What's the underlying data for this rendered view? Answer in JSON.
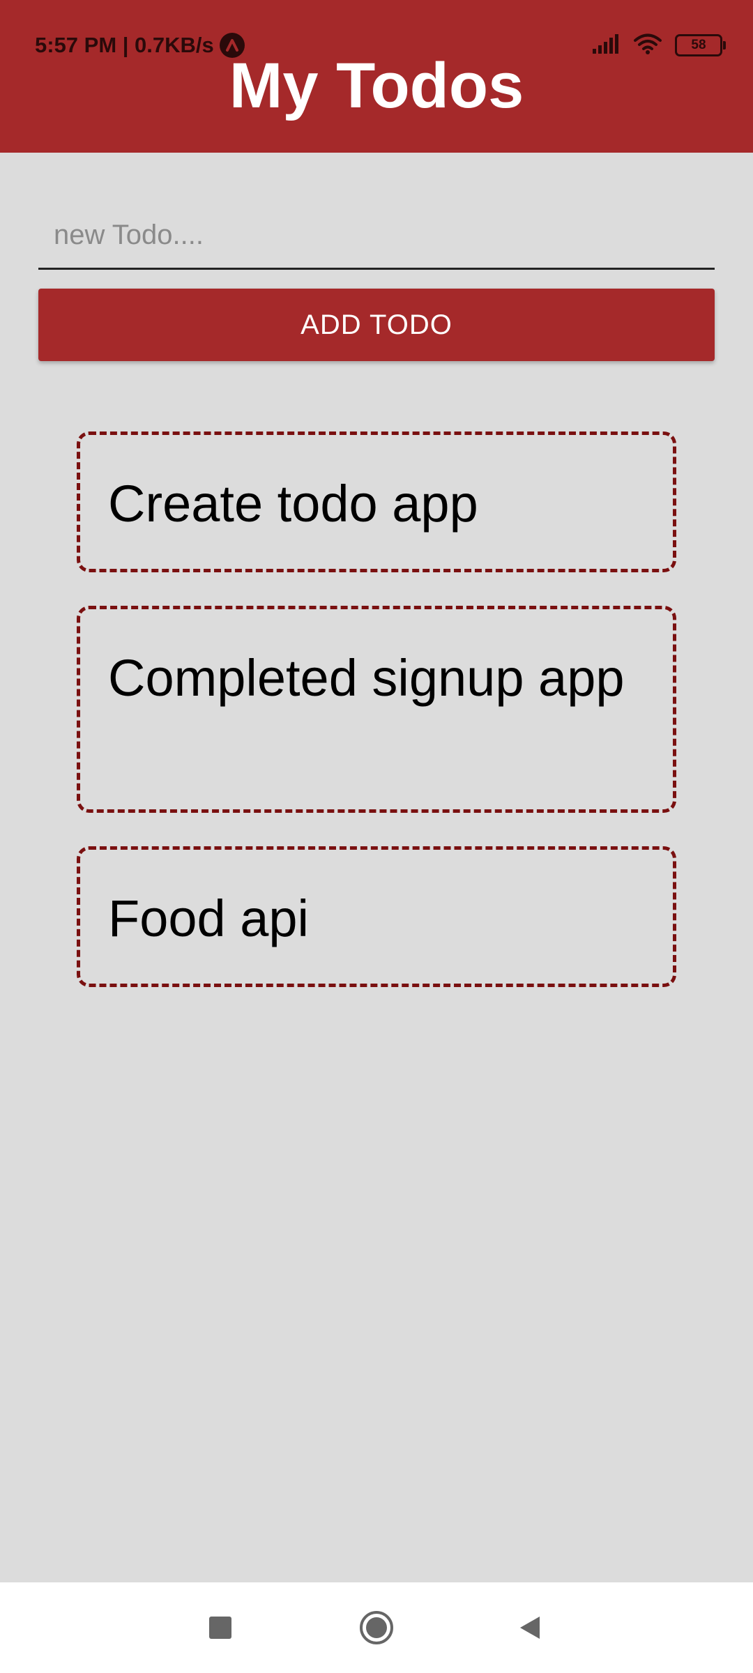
{
  "status_bar": {
    "time": "5:57 PM",
    "network_speed": "0.7KB/s",
    "status_text": "5:57 PM | 0.7KB/s",
    "battery_level": "58",
    "icons": [
      "app-notification-icon",
      "signal-icon",
      "wifi-icon",
      "battery-icon"
    ]
  },
  "header": {
    "title": "My Todos"
  },
  "new_todo": {
    "placeholder": "new Todo....",
    "value": ""
  },
  "add_button": {
    "label": "ADD TODO"
  },
  "todos": [
    {
      "text": "Create todo app"
    },
    {
      "text": "Completed signup app"
    },
    {
      "text": "Food api"
    }
  ],
  "nav_bar": {
    "icons": [
      "recents-square-icon",
      "home-circle-icon",
      "back-triangle-icon"
    ]
  },
  "colors": {
    "header_bg": "#a5292a",
    "button_bg": "#a5292a",
    "page_bg": "#dcdcdc",
    "todo_border": "#7a1010"
  }
}
